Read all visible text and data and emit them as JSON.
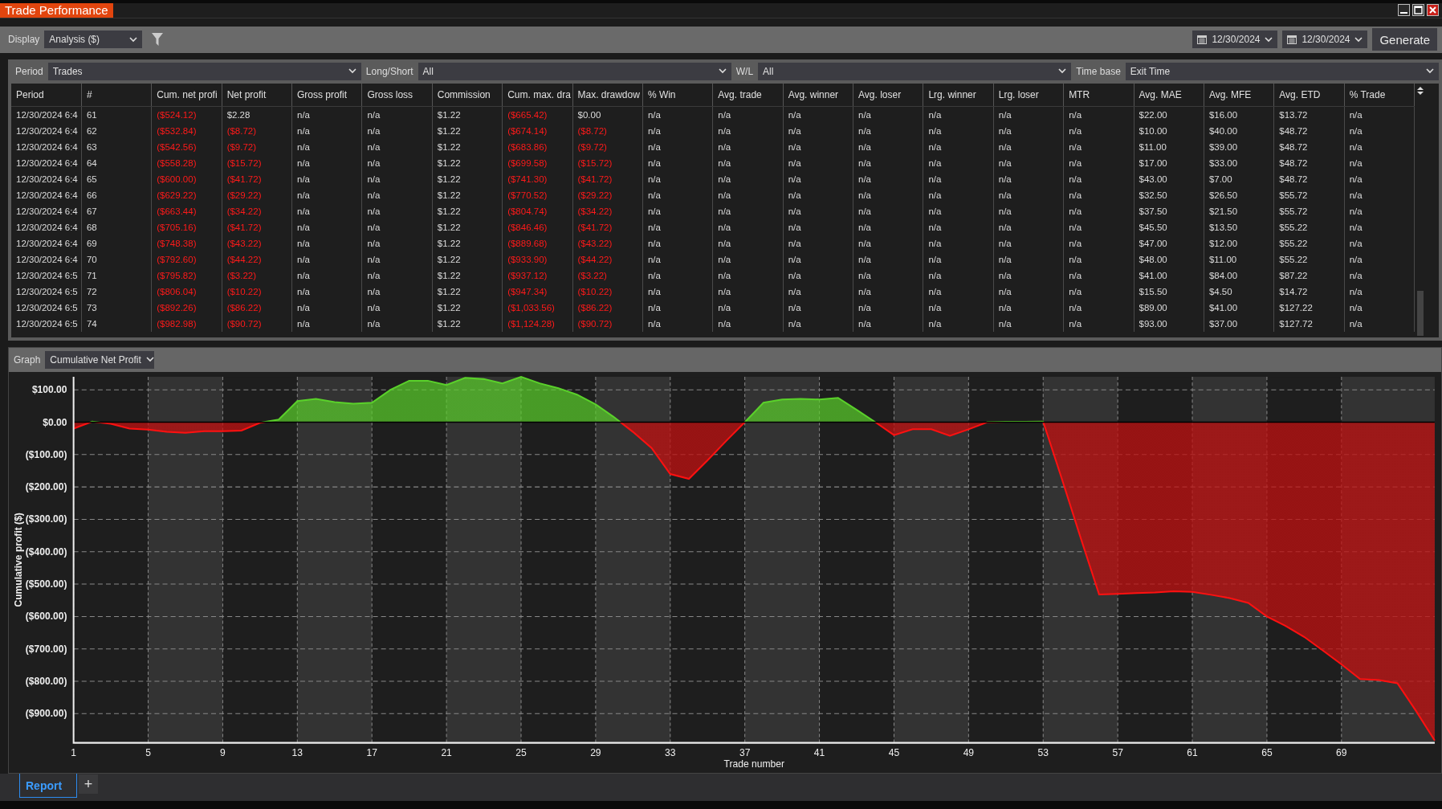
{
  "window": {
    "title": "Trade Performance"
  },
  "toolbar": {
    "display_label": "Display",
    "display_value": "Analysis ($)",
    "start_date": "12/30/2024",
    "end_date": "12/30/2024",
    "generate": "Generate"
  },
  "filters": [
    {
      "label": "Period",
      "value": "Trades"
    },
    {
      "label": "Long/Short",
      "value": "All"
    },
    {
      "label": "W/L",
      "value": "All"
    },
    {
      "label": "Time base",
      "value": "Exit Time"
    }
  ],
  "table": {
    "columns": [
      "Period",
      "#",
      "Cum. net profi",
      "Net profit",
      "Gross profit",
      "Gross loss",
      "Commission",
      "Cum. max. dra",
      "Max. drawdow",
      "% Win",
      "Avg. trade",
      "Avg. winner",
      "Avg. loser",
      "Lrg. winner",
      "Lrg. loser",
      "MTR",
      "Avg. MAE",
      "Avg. MFE",
      "Avg. ETD",
      "% Trade"
    ],
    "rows": [
      {
        "cells": [
          "12/30/2024 6:4",
          "61",
          "($524.12)",
          "$2.28",
          "n/a",
          "n/a",
          "$1.22",
          "($665.42)",
          "$0.00",
          "n/a",
          "n/a",
          "n/a",
          "n/a",
          "n/a",
          "n/a",
          "n/a",
          "$22.00",
          "$16.00",
          "$13.72",
          "n/a"
        ],
        "loss": [
          false,
          false,
          true,
          false,
          false,
          false,
          false,
          true,
          false,
          false,
          false,
          false,
          false,
          false,
          false,
          false,
          false,
          false,
          false,
          false
        ]
      },
      {
        "cells": [
          "12/30/2024 6:4",
          "62",
          "($532.84)",
          "($8.72)",
          "n/a",
          "n/a",
          "$1.22",
          "($674.14)",
          "($8.72)",
          "n/a",
          "n/a",
          "n/a",
          "n/a",
          "n/a",
          "n/a",
          "n/a",
          "$10.00",
          "$40.00",
          "$48.72",
          "n/a"
        ],
        "loss": [
          false,
          false,
          true,
          true,
          false,
          false,
          false,
          true,
          true,
          false,
          false,
          false,
          false,
          false,
          false,
          false,
          false,
          false,
          false,
          false
        ]
      },
      {
        "cells": [
          "12/30/2024 6:4",
          "63",
          "($542.56)",
          "($9.72)",
          "n/a",
          "n/a",
          "$1.22",
          "($683.86)",
          "($9.72)",
          "n/a",
          "n/a",
          "n/a",
          "n/a",
          "n/a",
          "n/a",
          "n/a",
          "$11.00",
          "$39.00",
          "$48.72",
          "n/a"
        ],
        "loss": [
          false,
          false,
          true,
          true,
          false,
          false,
          false,
          true,
          true,
          false,
          false,
          false,
          false,
          false,
          false,
          false,
          false,
          false,
          false,
          false
        ]
      },
      {
        "cells": [
          "12/30/2024 6:4",
          "64",
          "($558.28)",
          "($15.72)",
          "n/a",
          "n/a",
          "$1.22",
          "($699.58)",
          "($15.72)",
          "n/a",
          "n/a",
          "n/a",
          "n/a",
          "n/a",
          "n/a",
          "n/a",
          "$17.00",
          "$33.00",
          "$48.72",
          "n/a"
        ],
        "loss": [
          false,
          false,
          true,
          true,
          false,
          false,
          false,
          true,
          true,
          false,
          false,
          false,
          false,
          false,
          false,
          false,
          false,
          false,
          false,
          false
        ]
      },
      {
        "cells": [
          "12/30/2024 6:4",
          "65",
          "($600.00)",
          "($41.72)",
          "n/a",
          "n/a",
          "$1.22",
          "($741.30)",
          "($41.72)",
          "n/a",
          "n/a",
          "n/a",
          "n/a",
          "n/a",
          "n/a",
          "n/a",
          "$43.00",
          "$7.00",
          "$48.72",
          "n/a"
        ],
        "loss": [
          false,
          false,
          true,
          true,
          false,
          false,
          false,
          true,
          true,
          false,
          false,
          false,
          false,
          false,
          false,
          false,
          false,
          false,
          false,
          false
        ]
      },
      {
        "cells": [
          "12/30/2024 6:4",
          "66",
          "($629.22)",
          "($29.22)",
          "n/a",
          "n/a",
          "$1.22",
          "($770.52)",
          "($29.22)",
          "n/a",
          "n/a",
          "n/a",
          "n/a",
          "n/a",
          "n/a",
          "n/a",
          "$32.50",
          "$26.50",
          "$55.72",
          "n/a"
        ],
        "loss": [
          false,
          false,
          true,
          true,
          false,
          false,
          false,
          true,
          true,
          false,
          false,
          false,
          false,
          false,
          false,
          false,
          false,
          false,
          false,
          false
        ]
      },
      {
        "cells": [
          "12/30/2024 6:4",
          "67",
          "($663.44)",
          "($34.22)",
          "n/a",
          "n/a",
          "$1.22",
          "($804.74)",
          "($34.22)",
          "n/a",
          "n/a",
          "n/a",
          "n/a",
          "n/a",
          "n/a",
          "n/a",
          "$37.50",
          "$21.50",
          "$55.72",
          "n/a"
        ],
        "loss": [
          false,
          false,
          true,
          true,
          false,
          false,
          false,
          true,
          true,
          false,
          false,
          false,
          false,
          false,
          false,
          false,
          false,
          false,
          false,
          false
        ]
      },
      {
        "cells": [
          "12/30/2024 6:4",
          "68",
          "($705.16)",
          "($41.72)",
          "n/a",
          "n/a",
          "$1.22",
          "($846.46)",
          "($41.72)",
          "n/a",
          "n/a",
          "n/a",
          "n/a",
          "n/a",
          "n/a",
          "n/a",
          "$45.50",
          "$13.50",
          "$55.22",
          "n/a"
        ],
        "loss": [
          false,
          false,
          true,
          true,
          false,
          false,
          false,
          true,
          true,
          false,
          false,
          false,
          false,
          false,
          false,
          false,
          false,
          false,
          false,
          false
        ]
      },
      {
        "cells": [
          "12/30/2024 6:4",
          "69",
          "($748.38)",
          "($43.22)",
          "n/a",
          "n/a",
          "$1.22",
          "($889.68)",
          "($43.22)",
          "n/a",
          "n/a",
          "n/a",
          "n/a",
          "n/a",
          "n/a",
          "n/a",
          "$47.00",
          "$12.00",
          "$55.22",
          "n/a"
        ],
        "loss": [
          false,
          false,
          true,
          true,
          false,
          false,
          false,
          true,
          true,
          false,
          false,
          false,
          false,
          false,
          false,
          false,
          false,
          false,
          false,
          false
        ]
      },
      {
        "cells": [
          "12/30/2024 6:4",
          "70",
          "($792.60)",
          "($44.22)",
          "n/a",
          "n/a",
          "$1.22",
          "($933.90)",
          "($44.22)",
          "n/a",
          "n/a",
          "n/a",
          "n/a",
          "n/a",
          "n/a",
          "n/a",
          "$48.00",
          "$11.00",
          "$55.22",
          "n/a"
        ],
        "loss": [
          false,
          false,
          true,
          true,
          false,
          false,
          false,
          true,
          true,
          false,
          false,
          false,
          false,
          false,
          false,
          false,
          false,
          false,
          false,
          false
        ]
      },
      {
        "cells": [
          "12/30/2024 6:5",
          "71",
          "($795.82)",
          "($3.22)",
          "n/a",
          "n/a",
          "$1.22",
          "($937.12)",
          "($3.22)",
          "n/a",
          "n/a",
          "n/a",
          "n/a",
          "n/a",
          "n/a",
          "n/a",
          "$41.00",
          "$84.00",
          "$87.22",
          "n/a"
        ],
        "loss": [
          false,
          false,
          true,
          true,
          false,
          false,
          false,
          true,
          true,
          false,
          false,
          false,
          false,
          false,
          false,
          false,
          false,
          false,
          false,
          false
        ]
      },
      {
        "cells": [
          "12/30/2024 6:5",
          "72",
          "($806.04)",
          "($10.22)",
          "n/a",
          "n/a",
          "$1.22",
          "($947.34)",
          "($10.22)",
          "n/a",
          "n/a",
          "n/a",
          "n/a",
          "n/a",
          "n/a",
          "n/a",
          "$15.50",
          "$4.50",
          "$14.72",
          "n/a"
        ],
        "loss": [
          false,
          false,
          true,
          true,
          false,
          false,
          false,
          true,
          true,
          false,
          false,
          false,
          false,
          false,
          false,
          false,
          false,
          false,
          false,
          false
        ]
      },
      {
        "cells": [
          "12/30/2024 6:5",
          "73",
          "($892.26)",
          "($86.22)",
          "n/a",
          "n/a",
          "$1.22",
          "($1,033.56)",
          "($86.22)",
          "n/a",
          "n/a",
          "n/a",
          "n/a",
          "n/a",
          "n/a",
          "n/a",
          "$89.00",
          "$41.00",
          "$127.22",
          "n/a"
        ],
        "loss": [
          false,
          false,
          true,
          true,
          false,
          false,
          false,
          true,
          true,
          false,
          false,
          false,
          false,
          false,
          false,
          false,
          false,
          false,
          false,
          false
        ]
      },
      {
        "cells": [
          "12/30/2024 6:5",
          "74",
          "($982.98)",
          "($90.72)",
          "n/a",
          "n/a",
          "$1.22",
          "($1,124.28)",
          "($90.72)",
          "n/a",
          "n/a",
          "n/a",
          "n/a",
          "n/a",
          "n/a",
          "n/a",
          "$93.00",
          "$37.00",
          "$127.72",
          "n/a"
        ],
        "loss": [
          false,
          false,
          true,
          true,
          false,
          false,
          false,
          true,
          true,
          false,
          false,
          false,
          false,
          false,
          false,
          false,
          false,
          false,
          false,
          false
        ]
      }
    ]
  },
  "graph": {
    "label": "Graph",
    "value": "Cumulative Net Profit",
    "chart_data": {
      "type": "area",
      "xlabel": "Trade number",
      "ylabel": "Cumulative profit ($)",
      "x": [
        1,
        2,
        3,
        4,
        5,
        6,
        7,
        8,
        9,
        10,
        11,
        12,
        13,
        14,
        15,
        16,
        17,
        18,
        19,
        20,
        21,
        22,
        23,
        24,
        25,
        26,
        27,
        28,
        29,
        30,
        31,
        32,
        33,
        34,
        35,
        36,
        37,
        38,
        39,
        40,
        41,
        42,
        43,
        44,
        45,
        46,
        47,
        48,
        49,
        50,
        51,
        52,
        53,
        54,
        55,
        56,
        57,
        58,
        59,
        60,
        61,
        62,
        63,
        64,
        65,
        66,
        67,
        68,
        69,
        70,
        71,
        72,
        73,
        74
      ],
      "series": [
        {
          "color": "#5ad12a",
          "values": [
            -20,
            2,
            -5,
            -20,
            -23,
            -30,
            -33,
            -28,
            -28,
            -26,
            -2,
            8,
            65,
            72,
            62,
            57,
            60,
            100,
            128,
            128,
            115,
            137,
            133,
            120,
            140,
            120,
            105,
            85,
            55,
            15,
            -30,
            -80,
            -160,
            -175,
            -118,
            -58,
            0,
            60,
            70,
            72,
            70,
            75,
            38,
            0,
            -40,
            -22,
            -22,
            -42,
            -22,
            0,
            1,
            1,
            2,
            -175,
            -355,
            -532,
            -530,
            -528,
            -526,
            -522,
            -524,
            -533,
            -543,
            -558,
            -600,
            -629,
            -663,
            -705,
            -748,
            -793,
            -796,
            -806,
            -892,
            -983
          ]
        }
      ],
      "grid": true,
      "xlim": [
        1,
        74
      ],
      "ylim": [
        -990,
        140
      ],
      "xticks": [
        1,
        5,
        9,
        13,
        17,
        21,
        25,
        29,
        33,
        37,
        41,
        45,
        49,
        53,
        57,
        61,
        65,
        69
      ],
      "yticks": [
        {
          "value": 100,
          "label": "$100.00"
        },
        {
          "value": 0,
          "label": "$0.00"
        },
        {
          "value": -100,
          "label": "($100.00)"
        },
        {
          "value": -200,
          "label": "($200.00)"
        },
        {
          "value": -300,
          "label": "($300.00)"
        },
        {
          "value": -400,
          "label": "($400.00)"
        },
        {
          "value": -500,
          "label": "($500.00)"
        },
        {
          "value": -600,
          "label": "($600.00)"
        },
        {
          "value": -700,
          "label": "($700.00)"
        },
        {
          "value": -800,
          "label": "($800.00)"
        },
        {
          "value": -900,
          "label": "($900.00)"
        }
      ]
    }
  },
  "tabs": [
    {
      "label": "Report",
      "selected": true
    }
  ],
  "add_tab": "+"
}
